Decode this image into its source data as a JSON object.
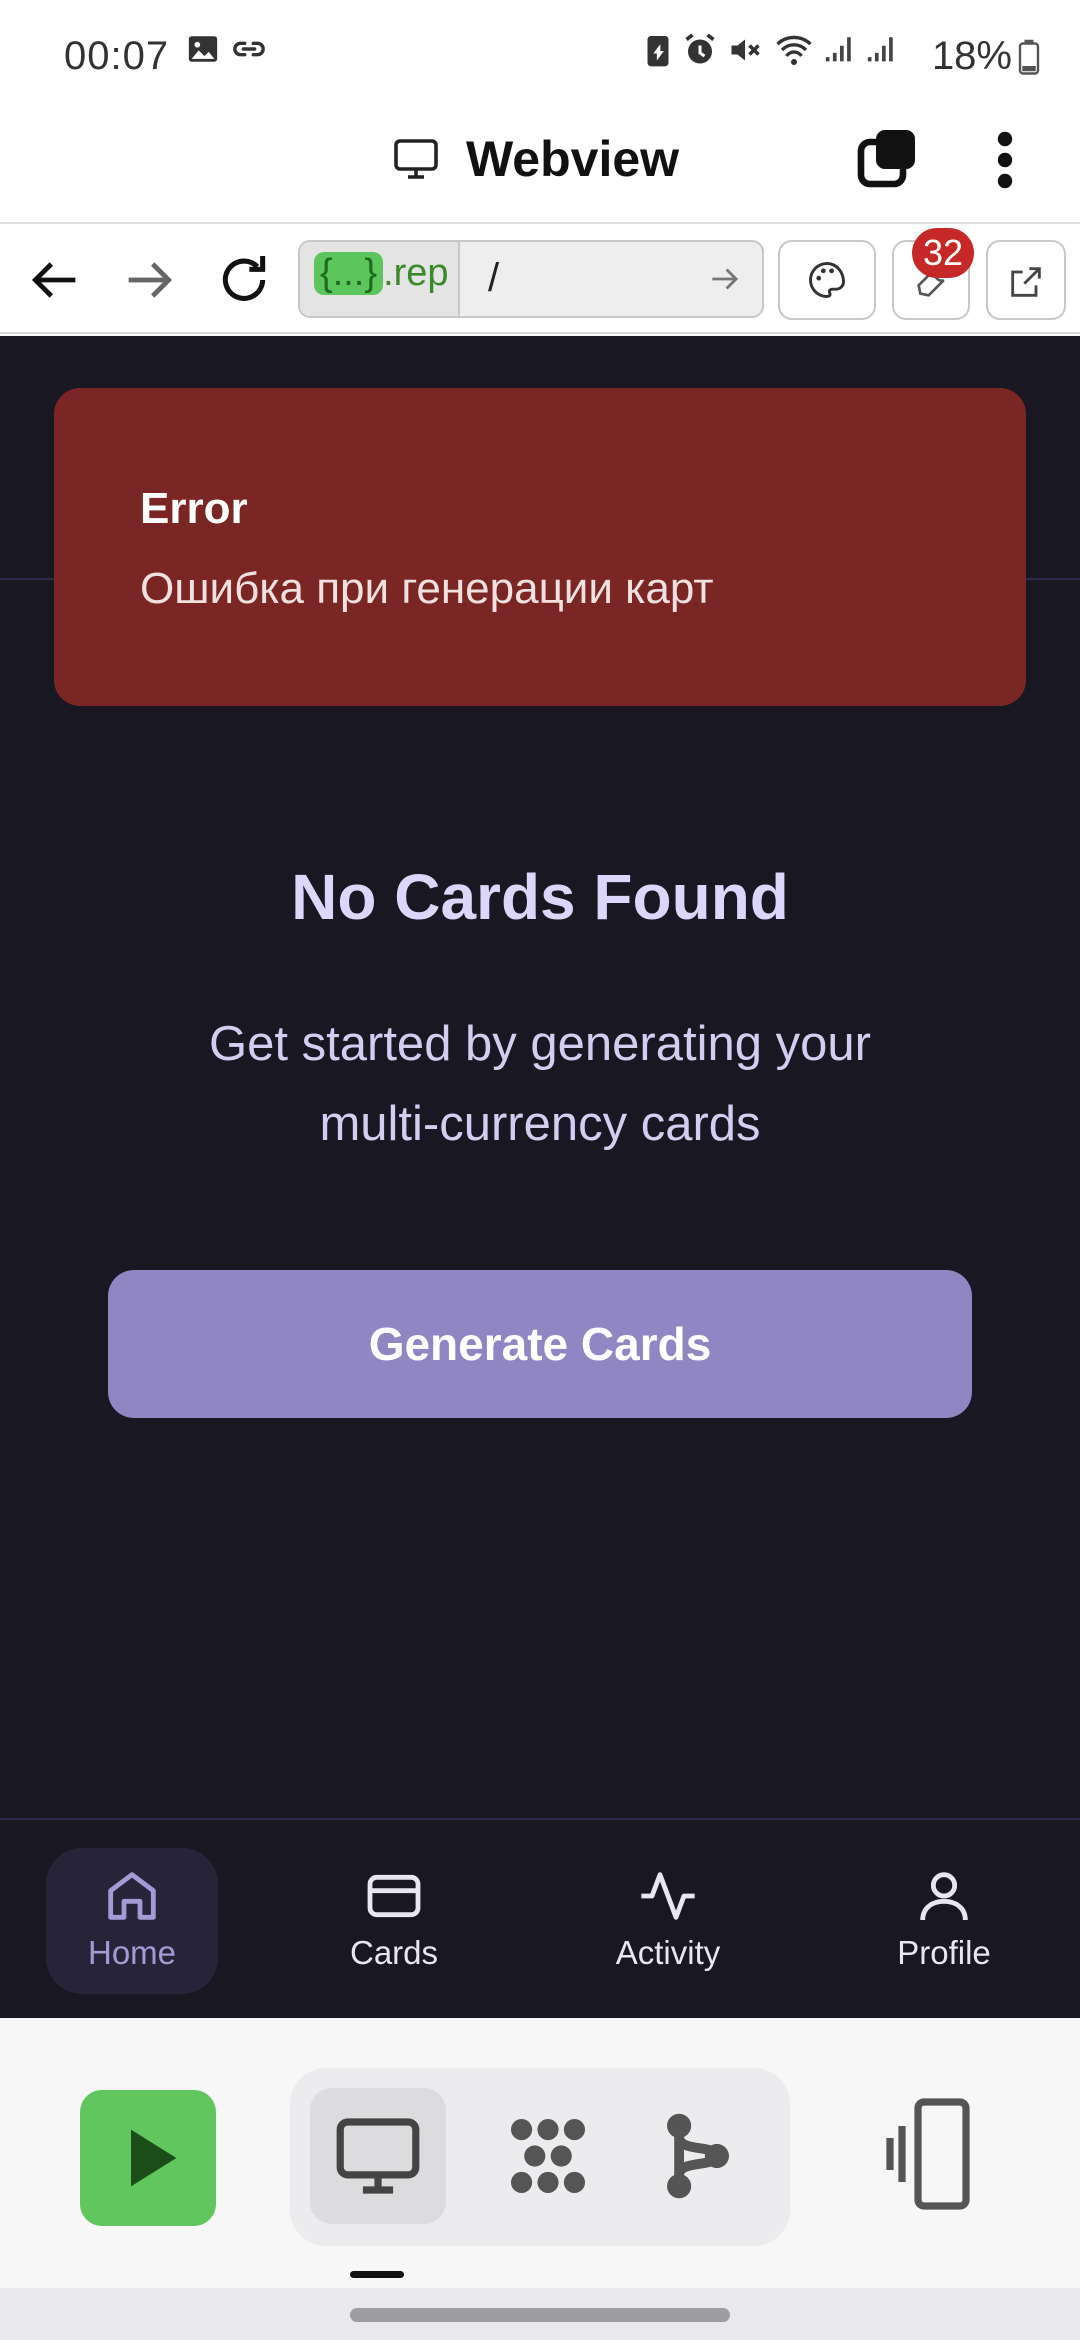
{
  "status": {
    "time": "00:07",
    "battery": "18%",
    "icons": [
      "image-icon",
      "link-icon",
      "battery-saver-icon",
      "alarm-icon",
      "mute-icon",
      "wifi-icon",
      "signal-icon",
      "signal-icon-2",
      "battery-icon"
    ]
  },
  "titlebar": {
    "title": "Webview"
  },
  "addressbar": {
    "host_tag": "{...}",
    "host_rest": ".rep",
    "path": "/",
    "badge_count": "32"
  },
  "error": {
    "title": "Error",
    "message": "Ошибка при генерации карт"
  },
  "empty": {
    "title": "No Cards Found",
    "subtitle_line1": "Get started by generating your",
    "subtitle_line2": "multi-currency cards",
    "button": "Generate Cards"
  },
  "bottom_nav": {
    "items": [
      {
        "label": "Home",
        "icon": "home-icon",
        "active": true
      },
      {
        "label": "Cards",
        "icon": "card-icon"
      },
      {
        "label": "Activity",
        "icon": "activity-icon"
      },
      {
        "label": "Profile",
        "icon": "user-icon"
      }
    ]
  },
  "colors": {
    "app_bg": "#181722",
    "error_bg": "#7a2624",
    "accent": "#8f86c3",
    "run_green": "#62c65e"
  }
}
